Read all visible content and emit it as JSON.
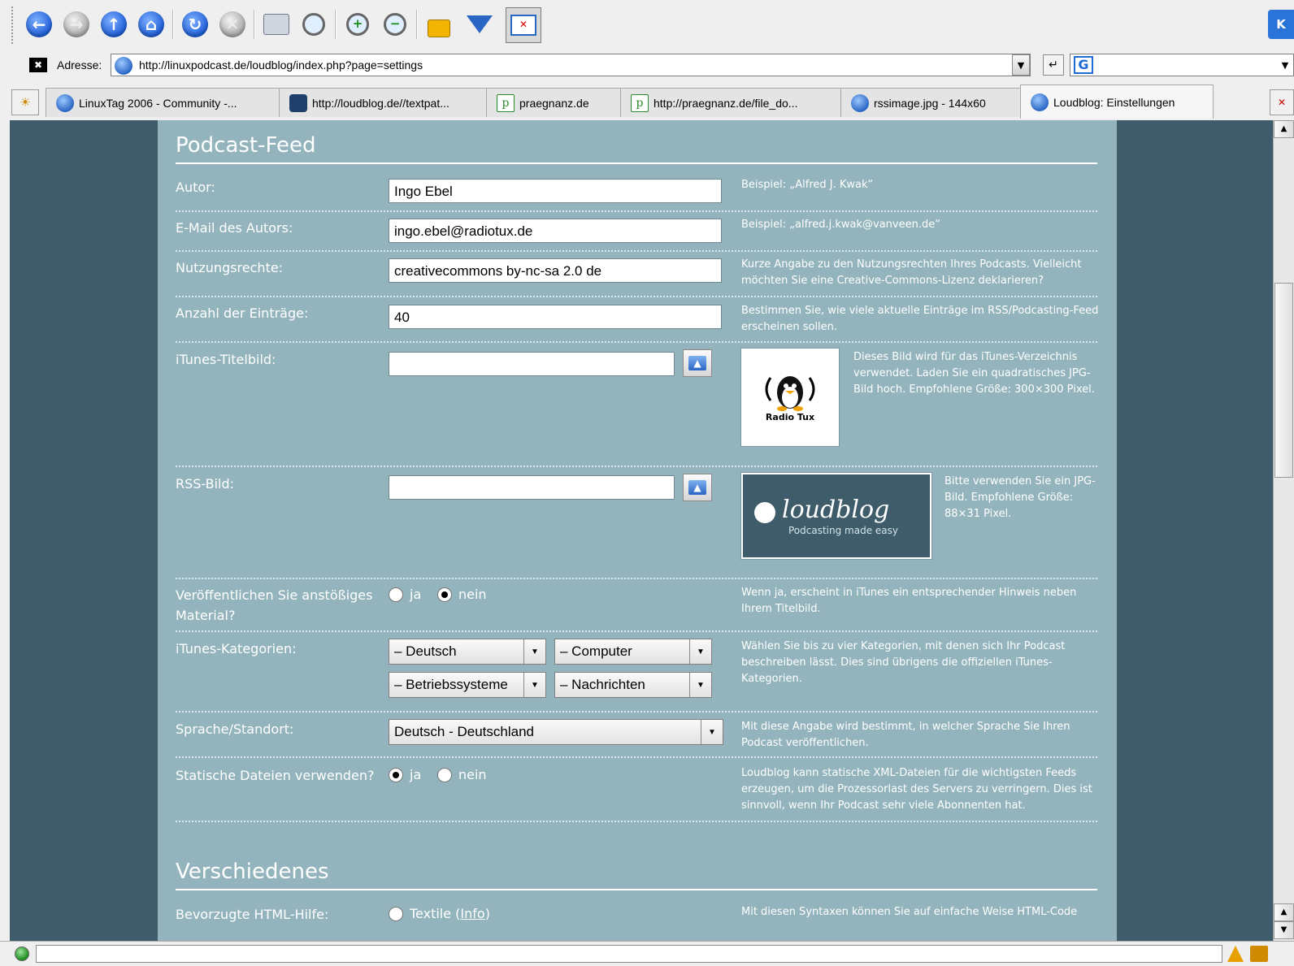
{
  "browser": {
    "address_label": "Adresse:",
    "url": "http://linuxpodcast.de/loudblog/index.php?page=settings",
    "tabs": [
      {
        "label": "LinuxTag 2006 - Community -...",
        "icon": "globe-icon"
      },
      {
        "label": "http://loudblog.de//textpat...",
        "icon": "loudblog-icon"
      },
      {
        "label": "praegnanz.de",
        "icon": "p-icon"
      },
      {
        "label": "http://praegnanz.de/file_do...",
        "icon": "p-icon"
      },
      {
        "label": "rssimage.jpg - 144x60",
        "icon": "globe-icon"
      },
      {
        "label": "Loudblog: Einstellungen",
        "icon": "globe-icon"
      }
    ],
    "toolbar_icons": [
      "back-icon",
      "forward-icon",
      "up-icon",
      "home-icon",
      "reload-icon",
      "stop-icon",
      "print-icon",
      "find-icon",
      "zoom-in-icon",
      "zoom-out-icon",
      "lock-icon",
      "download-icon",
      "fullscreen-icon"
    ]
  },
  "podcast_feed": {
    "title": "Podcast-Feed",
    "author_label": "Autor:",
    "author_value": "Ingo Ebel",
    "author_hint": "Beispiel: „Alfred J. Kwak“",
    "email_label": "E-Mail des Autors:",
    "email_value": "ingo.ebel@radiotux.de",
    "email_hint": "Beispiel: „alfred.j.kwak@vanveen.de“",
    "rights_label": "Nutzungsrechte:",
    "rights_value": "creativecommons by-nc-sa 2.0 de",
    "rights_hint": "Kurze Angabe zu den Nutzungsrechten Ihres Podcasts. Vielleicht möchten Sie eine Creative-Commons-Lizenz deklarieren?",
    "count_label": "Anzahl der Einträge:",
    "count_value": "40",
    "count_hint": "Bestimmen Sie, wie viele aktuelle Einträge im RSS/Podcasting-Feed erscheinen sollen.",
    "itunes_image_label": "iTunes-Titelbild:",
    "itunes_image_value": "",
    "itunes_image_caption": "Radio Tux",
    "itunes_image_hint": "Dieses Bild wird für das iTunes-Verzeichnis verwendet. Laden Sie ein quadratisches JPG-Bild hoch. Empfohlene Größe: 300×300 Pixel.",
    "rss_image_label": "RSS-Bild:",
    "rss_image_value": "",
    "rss_logo_text": "loudblog",
    "rss_logo_tagline": "Podcasting made easy",
    "rss_image_hint": "Bitte verwenden Sie ein JPG-Bild. Empfohlene Größe: 88×31 Pixel.",
    "explicit_label": "Veröffentlichen Sie anstößiges Material?",
    "explicit_yes": "ja",
    "explicit_no": "nein",
    "explicit_selected": "nein",
    "explicit_hint": "Wenn ja, erscheint in iTunes ein entsprechender Hinweis neben Ihrem Titelbild.",
    "categories_label": "iTunes-Kategorien:",
    "categories": [
      "– Deutsch",
      "– Computer",
      "– Betriebssysteme",
      "– Nachrichten"
    ],
    "categories_hint": "Wählen Sie bis zu vier Kategorien, mit denen sich Ihr Podcast beschreiben lässt. Dies sind übrigens die offiziellen iTunes-Kategorien.",
    "language_label": "Sprache/Standort:",
    "language_value": "Deutsch - Deutschland",
    "language_hint": "Mit diese Angabe wird bestimmt, in welcher Sprache Sie Ihren Podcast veröffentlichen.",
    "static_label": "Statische Dateien verwenden?",
    "static_yes": "ja",
    "static_no": "nein",
    "static_selected": "ja",
    "static_hint": "Loudblog kann statische XML-Dateien für die wichtigsten Feeds erzeugen, um die Prozessorlast des Servers zu verringern. Dies ist sinnvoll, wenn Ihr Podcast sehr viele Abonnenten hat."
  },
  "misc": {
    "title": "Verschiedenes",
    "html_help_label": "Bevorzugte HTML-Hilfe:",
    "option_textile": "Textile (",
    "option_textile_link": "Info",
    "option_textile_end": ")",
    "html_help_hint": "Mit diesen Syntaxen können Sie auf einfache Weise HTML-Code"
  }
}
